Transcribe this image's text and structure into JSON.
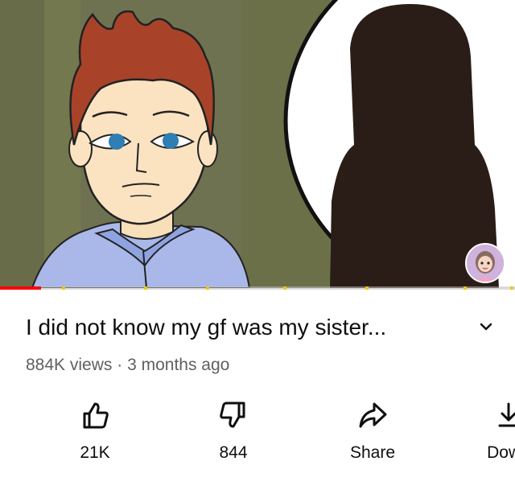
{
  "video": {
    "title": "I did not know my gf was my sister...",
    "views": "884K views",
    "separator": "·",
    "age": "3 months ago",
    "progress_fraction": 0.08,
    "chapter_fractions": [
      0.12,
      0.28,
      0.4,
      0.55,
      0.71,
      0.9,
      0.99
    ]
  },
  "actions": [
    {
      "label": "21K",
      "icon": "thumbs-up-icon"
    },
    {
      "label": "844",
      "icon": "thumbs-down-icon"
    },
    {
      "label": "Share",
      "icon": "share-icon"
    },
    {
      "label": "Down",
      "icon": "download-icon"
    }
  ],
  "colors": {
    "progress": "#ff0000",
    "chapter_marker": "#f7c400",
    "secondary_text": "#606060"
  }
}
